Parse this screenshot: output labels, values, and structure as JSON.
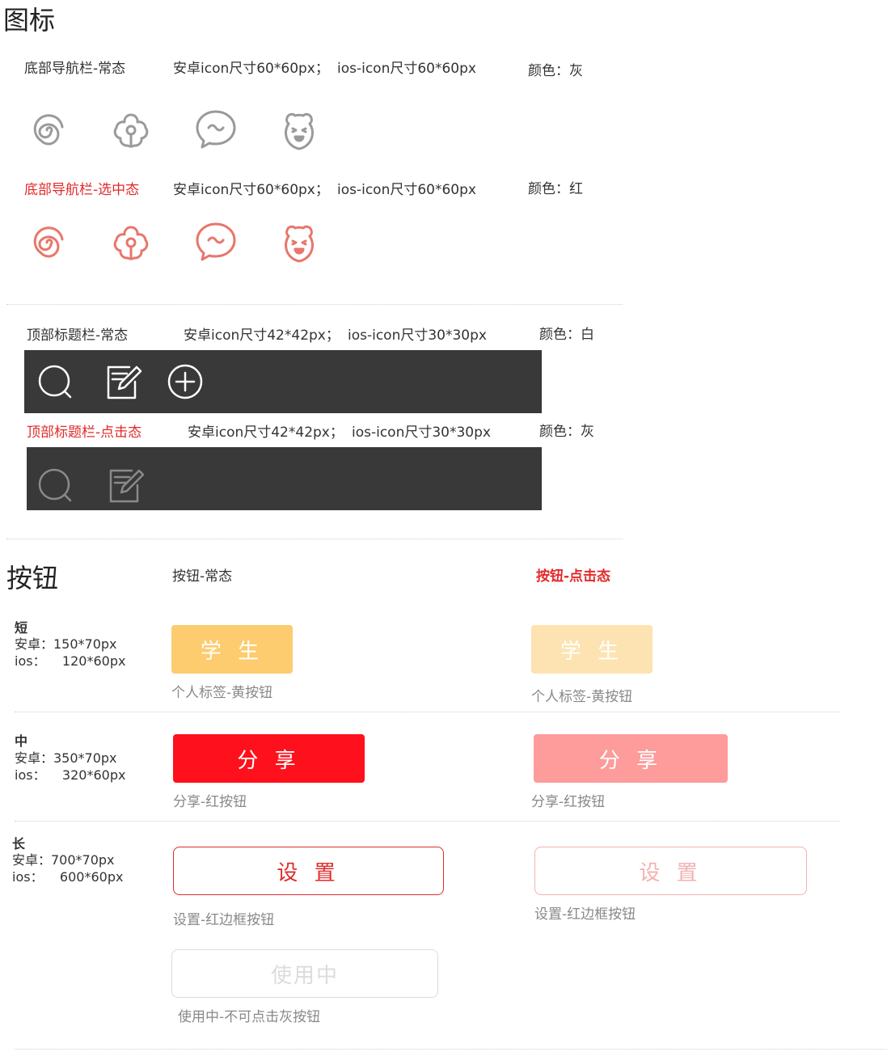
{
  "icons_section": {
    "title": "图标",
    "bottom_nav_normal": {
      "label": "底部导航栏-常态",
      "android": "安卓icon尺寸60*60px；",
      "ios": "ios-icon尺寸60*60px",
      "color": "颜色：灰"
    },
    "bottom_nav_selected": {
      "label": "底部导航栏-选中态",
      "android": "安卓icon尺寸60*60px；",
      "ios": "ios-icon尺寸60*60px",
      "color": "颜色：红"
    },
    "top_bar_normal": {
      "label": "顶部标题栏-常态",
      "android": "安卓icon尺寸42*42px；",
      "ios": "ios-icon尺寸30*30px",
      "color": "颜色：白"
    },
    "top_bar_pressed": {
      "label": "顶部标题栏-点击态",
      "android": "安卓icon尺寸42*42px；",
      "ios": "ios-icon尺寸30*30px",
      "color": "颜色：灰"
    },
    "nav_icon_names": [
      "spiral-icon",
      "flower-icon",
      "chat-bubble-icon",
      "bear-face-icon"
    ],
    "top_icon_names": [
      "search-icon",
      "edit-icon",
      "add-circle-icon"
    ],
    "colors": {
      "gray": "#9a9a9a",
      "red": "#e8766b",
      "bar": "#393939",
      "white": "#ffffff",
      "pressed": "#8a8a8a"
    }
  },
  "buttons_section": {
    "title": "按钮",
    "normal_header": "按钮-常态",
    "pressed_header": "按钮-点击态",
    "short": {
      "tag": "短",
      "android": "安卓：150*70px",
      "ios": "ios：    120*60px",
      "label": "学 生",
      "caption": "个人标签-黄按钮",
      "color": "#fdcc6e",
      "pressed_color": "#fde3b1"
    },
    "medium": {
      "tag": "中",
      "android": "安卓：350*70px",
      "ios": "ios：    320*60px",
      "label": "分 享",
      "caption": "分享-红按钮",
      "color": "#fe111c",
      "pressed_color": "#fe9b9b"
    },
    "long": {
      "tag": "长",
      "android": "安卓：700*70px",
      "ios": "ios：    600*60px",
      "label": "设 置",
      "caption": "设置-红边框按钮",
      "color": "#e22a2a",
      "pressed_color": "#f4b1b1"
    },
    "disabled": {
      "label": "使用中",
      "caption": "使用中-不可点击灰按钮"
    }
  }
}
